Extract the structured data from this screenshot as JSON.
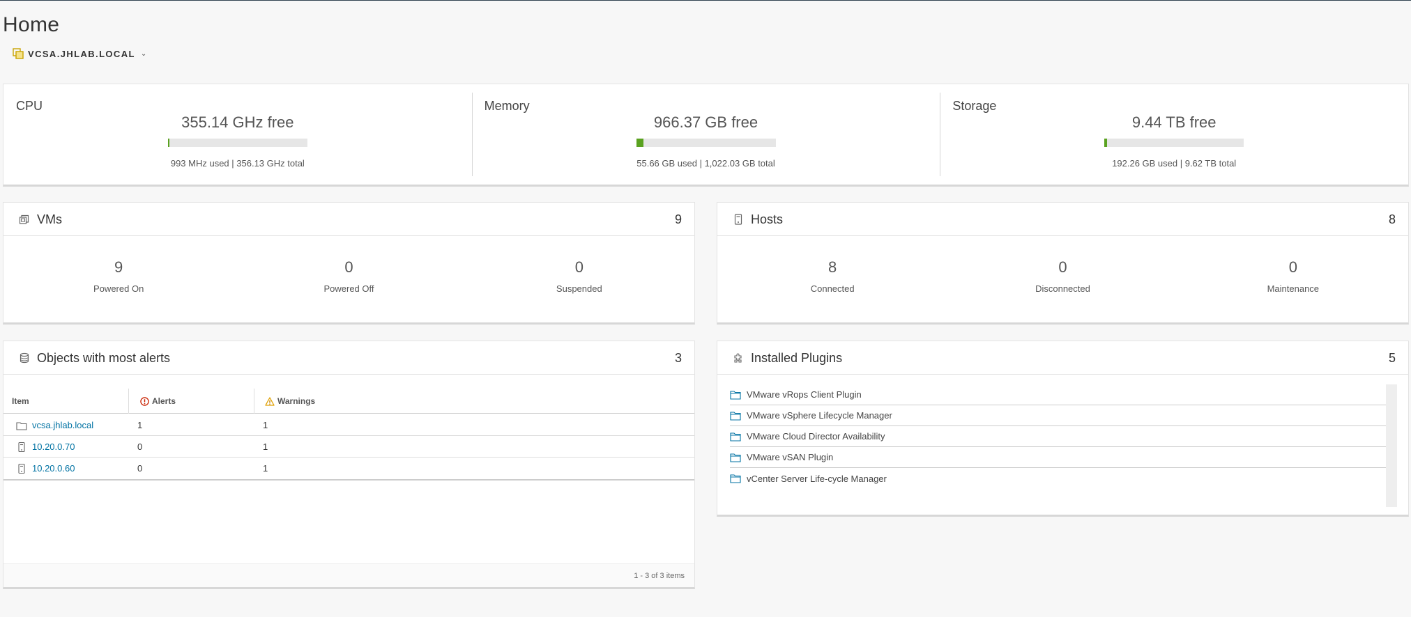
{
  "page": {
    "title": "Home"
  },
  "vcenter": {
    "name": "VCSA.JHLAB.LOCAL",
    "icon": "vcenter-icon"
  },
  "resources": [
    {
      "name": "CPU",
      "free": "355.14 GHz free",
      "used_fraction": 0.003,
      "detail": "993 MHz used | 356.13 GHz total"
    },
    {
      "name": "Memory",
      "free": "966.37 GB free",
      "used_fraction": 0.054,
      "detail": "55.66 GB used | 1,022.03 GB total"
    },
    {
      "name": "Storage",
      "free": "9.44 TB free",
      "used_fraction": 0.02,
      "detail": "192.26 GB used | 9.62 TB total"
    }
  ],
  "vms": {
    "title": "VMs",
    "count": "9",
    "icon": "vm-icon",
    "stats": [
      {
        "value": "9",
        "label": "Powered On"
      },
      {
        "value": "0",
        "label": "Powered Off"
      },
      {
        "value": "0",
        "label": "Suspended"
      }
    ]
  },
  "hosts": {
    "title": "Hosts",
    "count": "8",
    "icon": "host-icon",
    "stats": [
      {
        "value": "8",
        "label": "Connected"
      },
      {
        "value": "0",
        "label": "Disconnected"
      },
      {
        "value": "0",
        "label": "Maintenance"
      }
    ]
  },
  "alerts": {
    "title": "Objects with most alerts",
    "count": "3",
    "icon": "database-icon",
    "columns": {
      "item": "Item",
      "alerts": "Alerts",
      "warnings": "Warnings"
    },
    "rows": [
      {
        "icon": "folder-icon",
        "item": "vcsa.jhlab.local",
        "alerts": "1",
        "warnings": "1"
      },
      {
        "icon": "host-icon",
        "item": "10.20.0.70",
        "alerts": "0",
        "warnings": "1"
      },
      {
        "icon": "host-icon",
        "item": "10.20.0.60",
        "alerts": "0",
        "warnings": "1"
      }
    ],
    "footer": "1 - 3 of 3 items"
  },
  "plugins": {
    "title": "Installed Plugins",
    "count": "5",
    "icon": "plugin-icon",
    "items": [
      "VMware vRops Client Plugin",
      "VMware vSphere Lifecycle Manager",
      "VMware Cloud Director Availability",
      "VMware vSAN Plugin",
      "vCenter Server Life-cycle Manager"
    ]
  },
  "colors": {
    "link": "#0072a3",
    "bar_fill": "#5aa220",
    "alert": "#c92100",
    "warning": "#e0a000",
    "plugin_folder": "#0072a3"
  }
}
